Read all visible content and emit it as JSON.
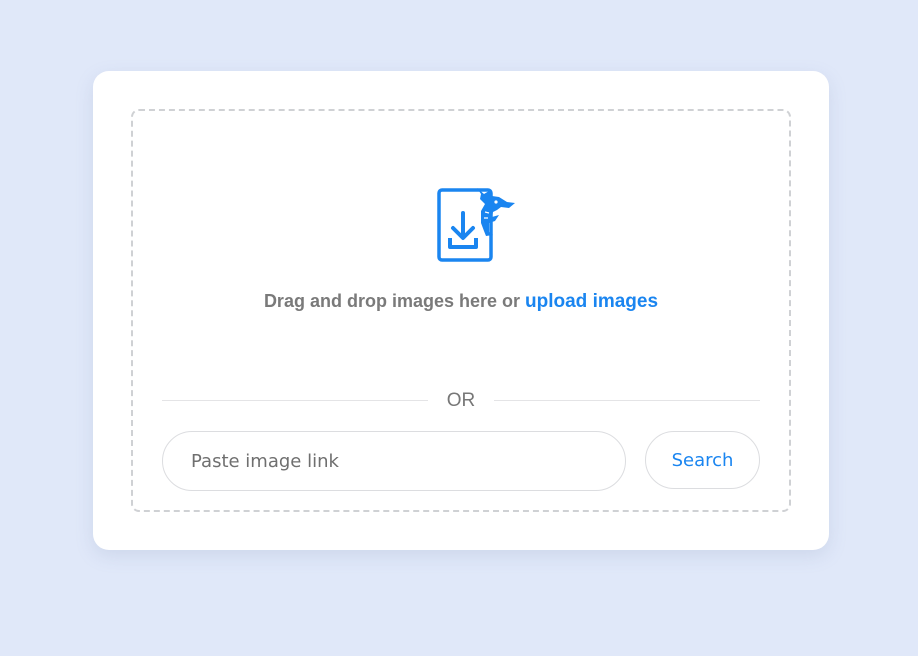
{
  "dropzone": {
    "icon": "upload-document-dragon-icon",
    "text": "Drag and drop images here or",
    "upload_link": "upload images"
  },
  "divider": {
    "label": "OR"
  },
  "link_search": {
    "placeholder": "Paste image link",
    "value": "",
    "button_label": "Search"
  },
  "colors": {
    "background": "#e0e8f9",
    "accent": "#1a85f0",
    "muted_text": "#7a7a7a"
  }
}
